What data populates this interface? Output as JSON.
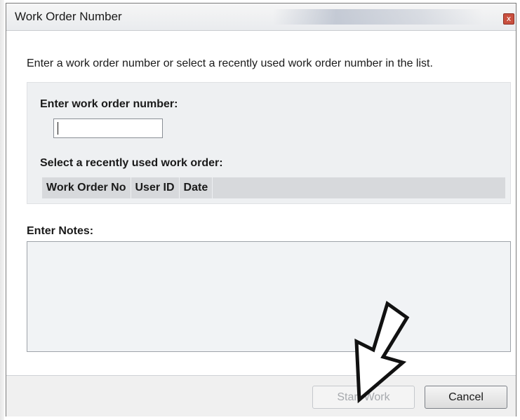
{
  "window": {
    "title": "Work Order Number",
    "close_glyph": "x"
  },
  "instruction": "Enter a work order number or select a recently used work order number in the list.",
  "work_order": {
    "label": "Enter work order number:",
    "value": "",
    "placeholder": ""
  },
  "recent": {
    "label": "Select a recently used work order:",
    "columns": [
      "Work Order No",
      "User ID",
      "Date"
    ],
    "rows": []
  },
  "notes": {
    "label": "Enter Notes:",
    "value": ""
  },
  "footer": {
    "start_label": "Start Work",
    "cancel_label": "Cancel"
  },
  "colors": {
    "close_button": "#c9503f",
    "group_background": "#eef0f2",
    "disabled_text": "#a6a9ad"
  },
  "icons": {
    "close": "close-icon",
    "annotation": "arrow-annotation-icon"
  }
}
